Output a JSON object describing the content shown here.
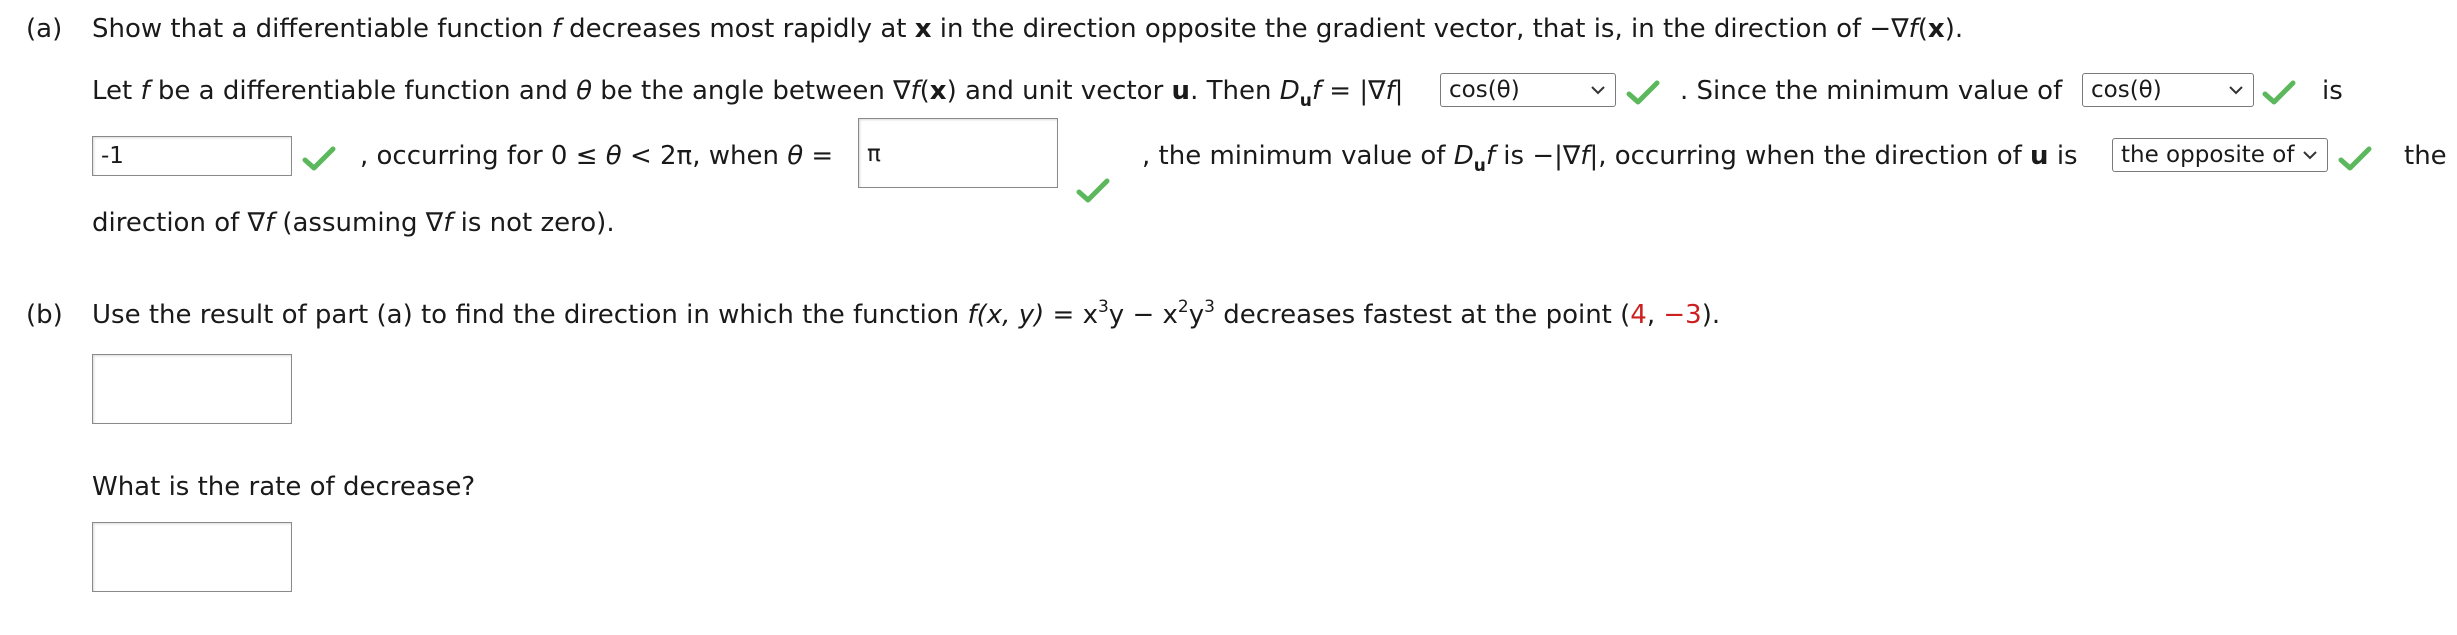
{
  "colors": {
    "check": "#5cb85c",
    "point": "#cc1f1f"
  },
  "part_a": {
    "label": "(a)",
    "prompt_1": "Show that a differentiable function",
    "f": "f",
    "prompt_2": "decreases most rapidly at",
    "x_bold": "x",
    "prompt_3": "in the direction opposite the gradient vector, that is, in the direction of −∇",
    "prompt_x_paren": "(",
    "prompt_close": ").",
    "line1_a": "Let",
    "line1_b": "be a differentiable function and",
    "theta": "θ",
    "line1_c": "be the angle between ∇",
    "line1_d": "and unit vector",
    "u_bold": "u",
    "line1_e": ". Then",
    "D": "D",
    "line1_f": "= |∇",
    "line1_g": "|",
    "select1": {
      "value": "cos(θ)",
      "icon": "chevron-down-icon"
    },
    "line1_h": ". Since the minimum value of",
    "select2": {
      "value": "cos(θ)",
      "icon": "chevron-down-icon"
    },
    "line1_is": "is",
    "input1": {
      "value": "-1"
    },
    "line2_a": ", occurring for 0 ≤",
    "line2_b": "< 2π, when",
    "line2_c": "=",
    "input2": {
      "value": "π"
    },
    "line2_d": ", the minimum value of",
    "line2_e": "is −|∇",
    "line2_f": "|, occurring when the direction of",
    "line2_g": "is",
    "select3": {
      "value": "the opposite of",
      "icon": "chevron-down-icon"
    },
    "line2_the": "the",
    "line3_a": "direction of ∇",
    "line3_b": "(assuming ∇",
    "line3_c": "is not zero)."
  },
  "part_b": {
    "label": "(b)",
    "prompt_1": "Use the result of part (a) to find the direction in which the function",
    "fxy": "f",
    "args": "(x, y)",
    "eq": "=",
    "x3y_a": "x",
    "exp3": "3",
    "x3y_b": "y",
    "minus": "−",
    "x2_a": "x",
    "exp2": "2",
    "y3_b": "y",
    "exp3b": "3",
    "prompt_2": "decreases fastest at the point (",
    "point_x": "4",
    "comma": ",",
    "point_y": "−3",
    "close": ").",
    "answer1": {
      "value": ""
    },
    "rate_question": "What is the rate of decrease?",
    "answer2": {
      "value": ""
    }
  }
}
